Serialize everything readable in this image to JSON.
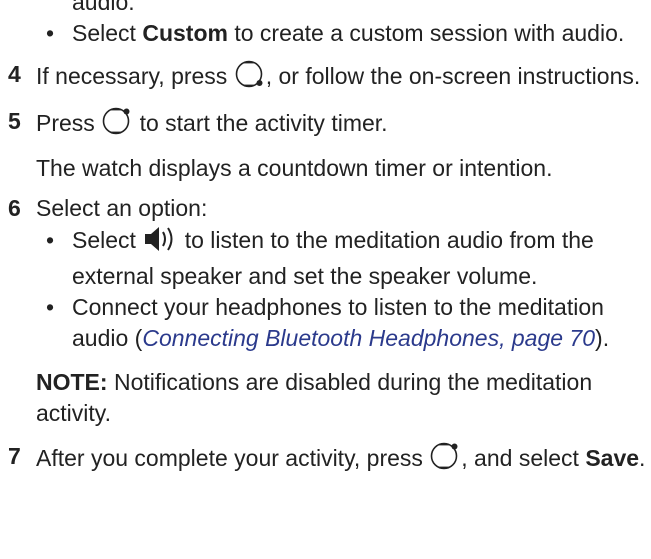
{
  "top_fragment": "audio.",
  "items": [
    {
      "kind": "bullet",
      "pre": "Select ",
      "bold": "Custom",
      "post": " to create a custom session with audio."
    },
    {
      "kind": "step",
      "num": "4",
      "pre": "If necessary, press ",
      "icon": "lower-right-button-icon",
      "post": ", or follow the on-screen instructions."
    },
    {
      "kind": "step",
      "num": "5",
      "pre": "Press ",
      "icon": "upper-right-button-icon",
      "post": " to start the activity timer."
    },
    {
      "kind": "para",
      "text": "The watch displays a countdown timer or intention."
    },
    {
      "kind": "step",
      "num": "6",
      "text": "Select an option:"
    },
    {
      "kind": "bullet",
      "pre": "Select ",
      "icon": "speaker-icon",
      "post": " to listen to the meditation audio from the external speaker and set the speaker volume."
    },
    {
      "kind": "bullet",
      "pre": "Connect your headphones to listen to the meditation audio (",
      "link": "Connecting Bluetooth Headphones, page 70",
      "post": ")."
    },
    {
      "kind": "note",
      "label": "NOTE:",
      "text": " Notifications are disabled during the meditation activity."
    },
    {
      "kind": "step",
      "num": "7",
      "pre": "After you complete your activity, press ",
      "icon": "upper-right-button-icon",
      "mid": ", and select ",
      "bold": "Save",
      "post": "."
    }
  ],
  "bullet_glyph": "•"
}
